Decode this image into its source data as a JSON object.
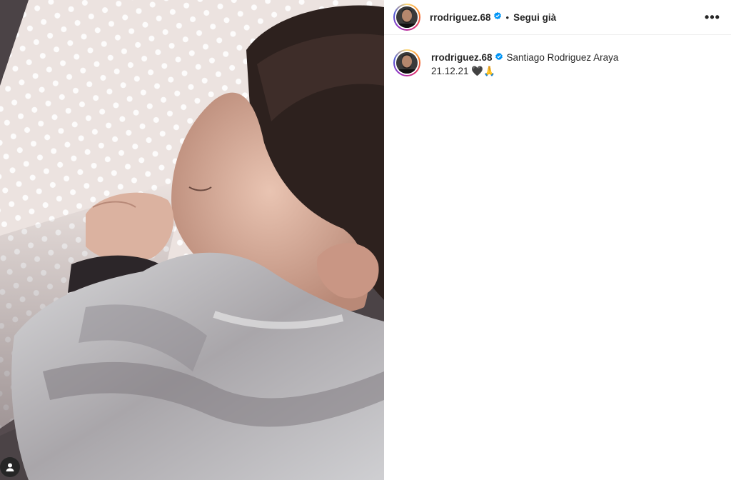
{
  "post": {
    "username": "rrodriguez.68",
    "verified": true,
    "separator": "•",
    "follow_status": "Segui già",
    "more_label": "•••"
  },
  "caption": {
    "username": "rrodriguez.68",
    "text": "Santiago Rodriguez Araya",
    "date_line": "21.12.21 🖤🙏"
  },
  "icons": {
    "verified": "verified-badge-icon",
    "more": "more-options-icon",
    "user_tag": "user-tag-icon"
  },
  "colors": {
    "verified_blue": "#0095f6",
    "text": "#262626",
    "divider": "#efefef"
  }
}
